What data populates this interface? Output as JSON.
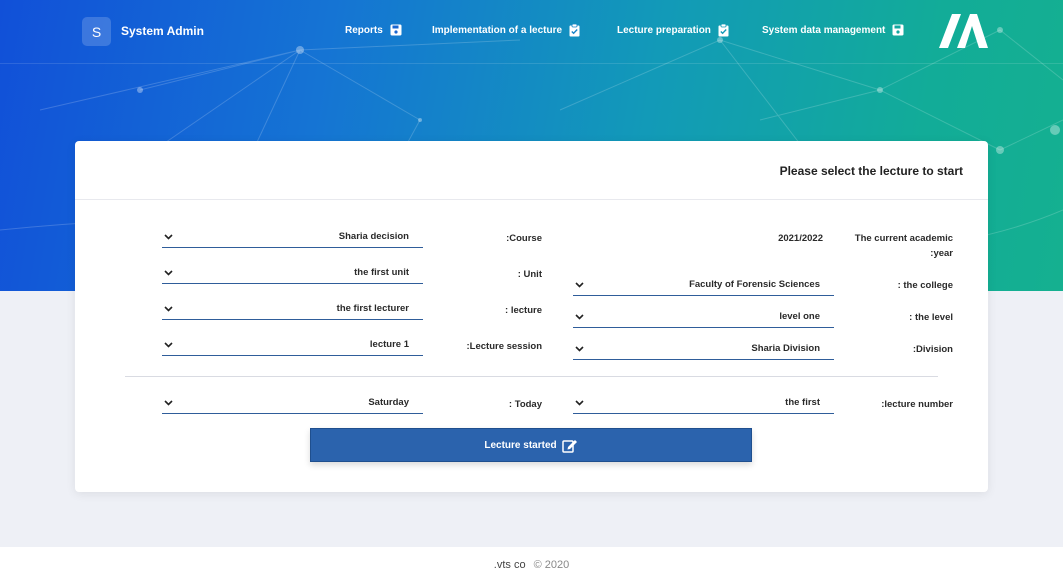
{
  "app": {
    "badge_letter": "S",
    "brand": "System Admin"
  },
  "nav": {
    "reports": "Reports",
    "implementation": "Implementation of a lecture",
    "preparation": "Lecture preparation",
    "system_data": "System data management"
  },
  "card": {
    "title": "Please select the lecture to start",
    "right_col": {
      "academic_year_label_1": "The current academic",
      "academic_year_label_2": ":year",
      "academic_year_value": "2021/2022",
      "college_label": ": the college",
      "college_value": "Faculty of Forensic Sciences",
      "level_label": ": the level",
      "level_value": "level one",
      "division_label": ":Division",
      "division_value": "Sharia Division",
      "lecture_number_label": ":lecture number",
      "lecture_number_value": "the first"
    },
    "left_col": {
      "course_label": ":Course",
      "course_value": "Sharia decision",
      "unit_label": ": Unit",
      "unit_value": "the first unit",
      "lecture_label": ": lecture",
      "lecture_value": "the first lecturer",
      "session_label": ":Lecture session",
      "session_value": "lecture 1",
      "today_label": ": Today",
      "today_value": "Saturday"
    },
    "start_button": "Lecture started"
  },
  "footer": {
    "company": ".vts co",
    "copyright": "© 2020"
  },
  "colors": {
    "accent": "#2b63ad",
    "underline": "#2f5d9a",
    "hero_start": "#1150d8",
    "hero_end": "#15b090"
  },
  "icons": {
    "save": "save-icon",
    "clipboard": "clipboard-check-icon",
    "chevron": "chevron-down-icon",
    "edit": "edit-icon"
  }
}
